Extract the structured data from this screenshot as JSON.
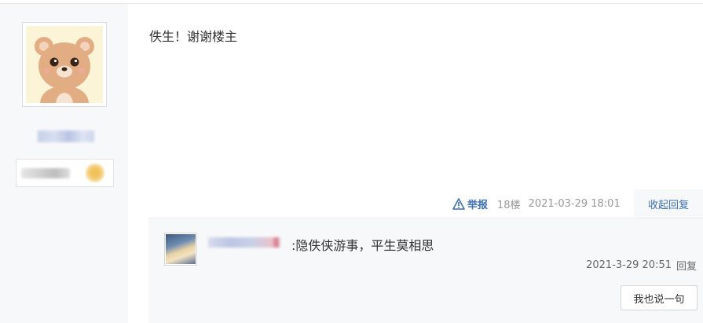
{
  "post": {
    "text": "佚生！谢谢楼主",
    "report_label": "举报",
    "floor": "18楼",
    "timestamp": "2021-03-29 18:01",
    "collapse_label": "收起回复"
  },
  "reply": {
    "separator": ":",
    "text": "隐佚侠游事，平生莫相思",
    "timestamp": "2021-3-29 20:51",
    "reply_label": "回复",
    "say_button": "我也说一句"
  },
  "colors": {
    "link": "#3b6fb6",
    "sidebar_bg": "#f7f8fa"
  },
  "icons": {
    "report": "warning-triangle-icon"
  }
}
